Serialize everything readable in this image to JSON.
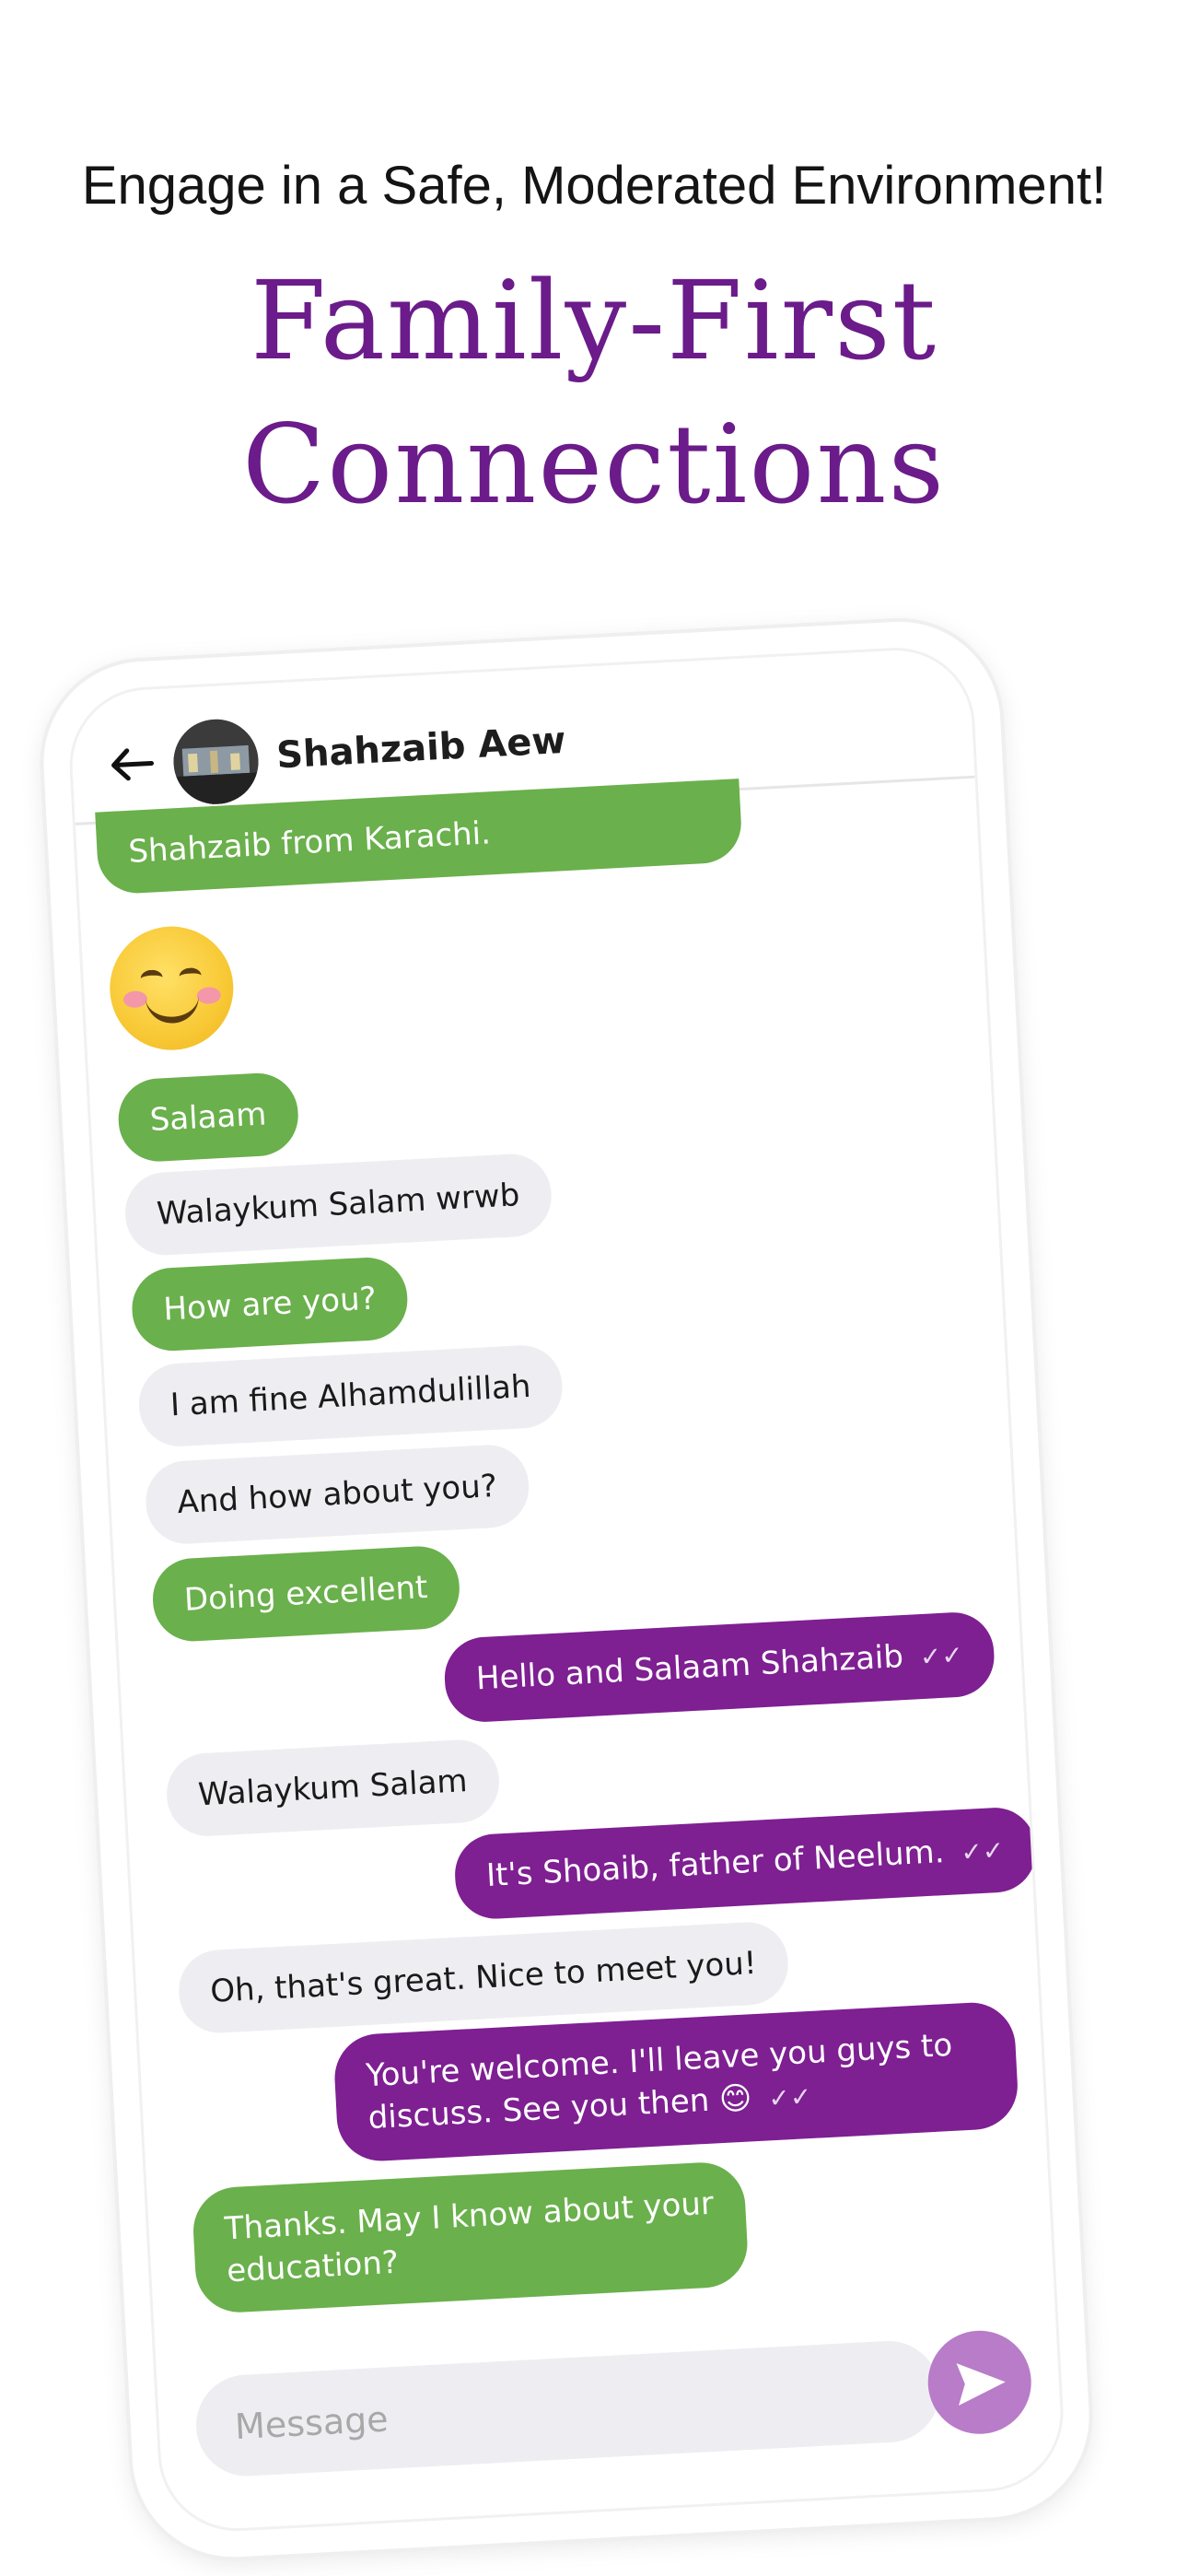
{
  "promo": {
    "subtitle": "Engage in a Safe, Moderated Environment!",
    "title_line1": "Family-First",
    "title_line2": "Connections"
  },
  "chat": {
    "contact_name": "Shahzaib Aew",
    "messages": [
      {
        "text": "Shahzaib from Karachi.",
        "type": "received"
      },
      {
        "text": "😊",
        "type": "emoji"
      },
      {
        "text": "Salaam",
        "type": "received"
      },
      {
        "text": "Walaykum Salam wrwb",
        "type": "grey"
      },
      {
        "text": "How are you?",
        "type": "received"
      },
      {
        "text": "I am fine Alhamdulillah",
        "type": "grey"
      },
      {
        "text": "And how about you?",
        "type": "grey"
      },
      {
        "text": "Doing excellent",
        "type": "received"
      },
      {
        "text": "Hello and Salaam Shahzaib",
        "type": "sent"
      },
      {
        "text": "Walaykum Salam",
        "type": "grey"
      },
      {
        "text": "It's Shoaib, father of Neelum.",
        "type": "sent"
      },
      {
        "text": "Oh, that's great. Nice to meet you!",
        "type": "grey"
      },
      {
        "text": "You're welcome. I'll leave you guys to discuss. See you then 😊",
        "type": "sent"
      },
      {
        "text": "Thanks. May I know about your education?",
        "type": "received"
      }
    ],
    "input_placeholder": "Message"
  },
  "colors": {
    "title_purple": "#6b1b8a",
    "green_bubble": "#6ab04c",
    "purple_bubble": "#7e1f92",
    "grey_bubble": "#eeeef2",
    "send_button": "#b87cc9"
  }
}
